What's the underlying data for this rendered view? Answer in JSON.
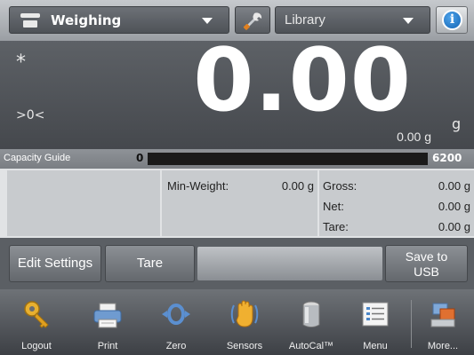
{
  "topbar": {
    "mode_label": "Weighing",
    "library_label": "Library"
  },
  "display": {
    "stable_indicator": "*",
    "zero_indicator": ">0<",
    "main_value": "0.00",
    "main_unit": "g",
    "secondary_value": "0.00 g"
  },
  "capacity": {
    "label": "Capacity Guide",
    "min": "0",
    "max": "6200",
    "fill_fraction": 0
  },
  "info": {
    "min_weight_label": "Min-Weight:",
    "min_weight_value": "0.00 g",
    "rows": [
      {
        "label": "Gross:",
        "value": "0.00 g"
      },
      {
        "label": "Net:",
        "value": "0.00 g"
      },
      {
        "label": "Tare:",
        "value": "0.00 g"
      }
    ]
  },
  "buttons": {
    "edit_settings": "Edit Settings",
    "tare": "Tare",
    "save_to_usb_line1": "Save to",
    "save_to_usb_line2": "USB"
  },
  "nav": [
    {
      "label": "Logout",
      "icon": "key-icon"
    },
    {
      "label": "Print",
      "icon": "printer-icon"
    },
    {
      "label": "Zero",
      "icon": "zero-icon"
    },
    {
      "label": "Sensors",
      "icon": "hand-sensor-icon"
    },
    {
      "label": "AutoCal™",
      "icon": "calibration-weight-icon"
    },
    {
      "label": "Menu",
      "icon": "menu-list-icon"
    },
    {
      "label": "More...",
      "icon": "more-icon"
    }
  ],
  "colors": {
    "info_blue": "#1464b4",
    "capacity_bar": "#1a1a1a",
    "key_gold": "#e0a020"
  }
}
